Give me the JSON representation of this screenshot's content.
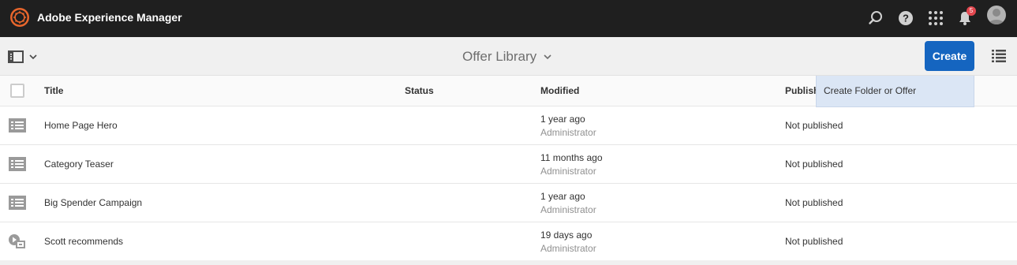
{
  "shell": {
    "app_title": "Adobe Experience Manager",
    "notification_count": "5",
    "icons": [
      "adobe-experience-cloud-logo",
      "search-icon",
      "help-icon",
      "solutions-grid-icon",
      "bell-icon",
      "user-avatar"
    ]
  },
  "actionbar": {
    "page_title": "Offer Library",
    "create_label": "Create",
    "accent_color": "#1565c0"
  },
  "table": {
    "columns": {
      "title": "Title",
      "status": "Status",
      "modified": "Modified",
      "published": "Publish"
    },
    "rows": [
      {
        "icon": "list-icon",
        "title": "Home Page Hero",
        "modified_when": "1 year ago",
        "modified_by": "Administrator",
        "published": "Not published"
      },
      {
        "icon": "list-icon",
        "title": "Category Teaser",
        "modified_when": "11 months ago",
        "modified_by": "Administrator",
        "published": "Not published"
      },
      {
        "icon": "list-icon",
        "title": "Big Spender Campaign",
        "modified_when": "1 year ago",
        "modified_by": "Administrator",
        "published": "Not published"
      },
      {
        "icon": "media-offer-icon",
        "title": "Scott recommends",
        "modified_when": "19 days ago",
        "modified_by": "Administrator",
        "published": "Not published"
      }
    ]
  },
  "create_menu": {
    "item": "Create Folder or Offer"
  }
}
